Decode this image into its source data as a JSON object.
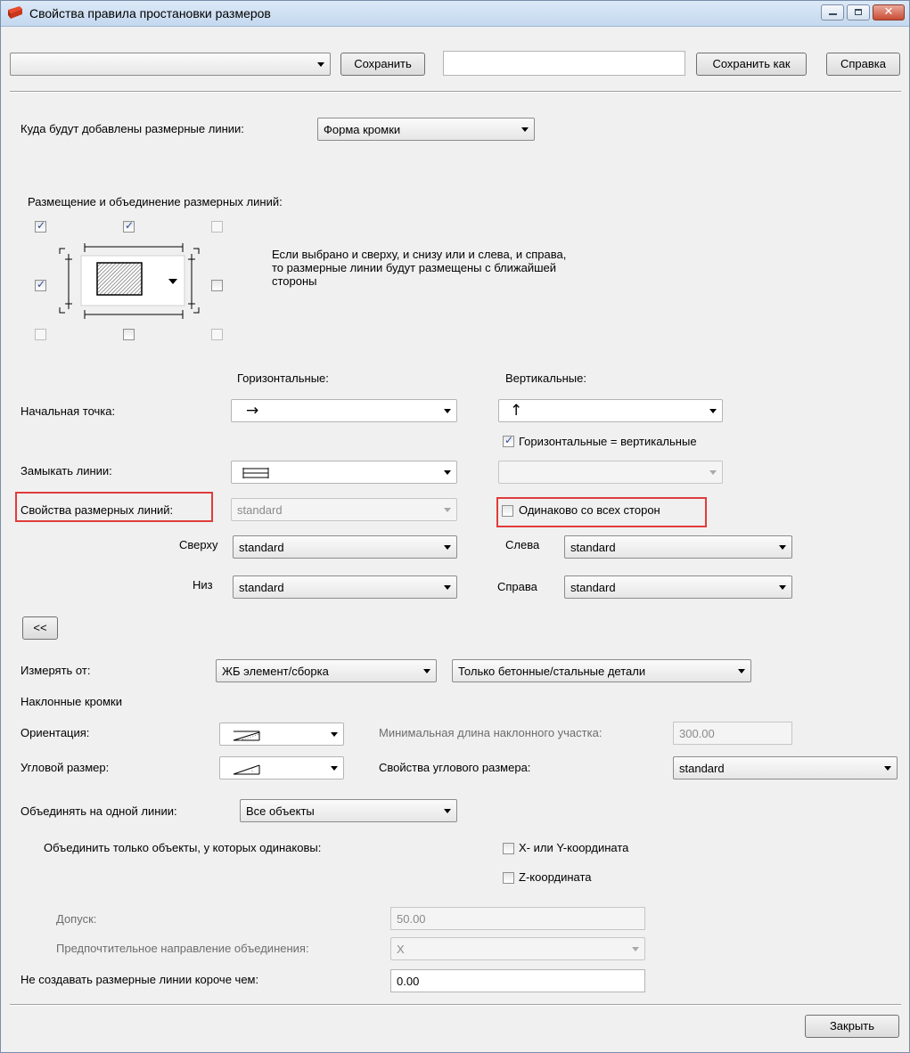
{
  "window": {
    "title": "Свойства правила простановки размеров"
  },
  "toolbar": {
    "preset_value": "",
    "save_label": "Сохранить",
    "save_as_name": "",
    "save_as_label": "Сохранить как",
    "help_label": "Справка"
  },
  "target": {
    "label": "Куда будут добавлены размерные линии:",
    "value": "Форма кромки"
  },
  "placement": {
    "label": "Размещение и объединение размерных линий:",
    "hint": "Если выбрано и сверху, и снизу или и слева, и справа, то размерные линии будут размещены с ближайшей стороны",
    "checks": {
      "top_left": true,
      "top": true,
      "top_right": false,
      "left": true,
      "right": false,
      "bottom_left": false,
      "bottom": false,
      "bottom_right": false
    }
  },
  "columns": {
    "horizontal": "Горизонтальные:",
    "vertical": "Вертикальные:"
  },
  "start_point": {
    "label": "Начальная точка:",
    "h_arrow": "→",
    "v_arrow": "↑"
  },
  "hv_equal": {
    "label": "Горизонтальные = вертикальные",
    "checked": true
  },
  "close_lines": {
    "label": "Замыкать линии:"
  },
  "dim_props": {
    "label": "Свойства размерных линий:",
    "value": "standard",
    "same_all_label": "Одинаково со всех сторон",
    "same_all_checked": false,
    "top_label": "Сверху",
    "top_value": "standard",
    "bottom_label": "Низ",
    "bottom_value": "standard",
    "left_label": "Слева",
    "left_value": "standard",
    "right_label": "Справа",
    "right_value": "standard"
  },
  "collapse_label": "<<",
  "measure_from": {
    "label": "Измерять от:",
    "value1": "ЖБ элемент/сборка",
    "value2": "Только бетонные/стальные детали"
  },
  "sloped": {
    "heading": "Наклонные кромки",
    "orientation_label": "Ориентация:",
    "min_length_label": "Минимальная длина наклонного участка:",
    "min_length_value": "300.00",
    "angular_label": "Угловой размер:",
    "angular_props_label": "Свойства углового размера:",
    "angular_props_value": "standard"
  },
  "combine": {
    "label": "Объединять на одной линии:",
    "value": "Все объекты",
    "only_label": "Объединить только объекты, у которых одинаковы:",
    "xy_label": "X- или Y-координата",
    "z_label": "Z-координата",
    "tolerance_label": "Допуск:",
    "tolerance_value": "50.00",
    "direction_label": "Предпочтительное направление объединения:",
    "direction_value": "X"
  },
  "min_length": {
    "label": "Не создавать размерные линии короче чем:",
    "value": "0.00"
  },
  "close_button": "Закрыть",
  "colors": {
    "highlight": "#e03c3c",
    "checkbox_mark": "#2a4b9a"
  }
}
